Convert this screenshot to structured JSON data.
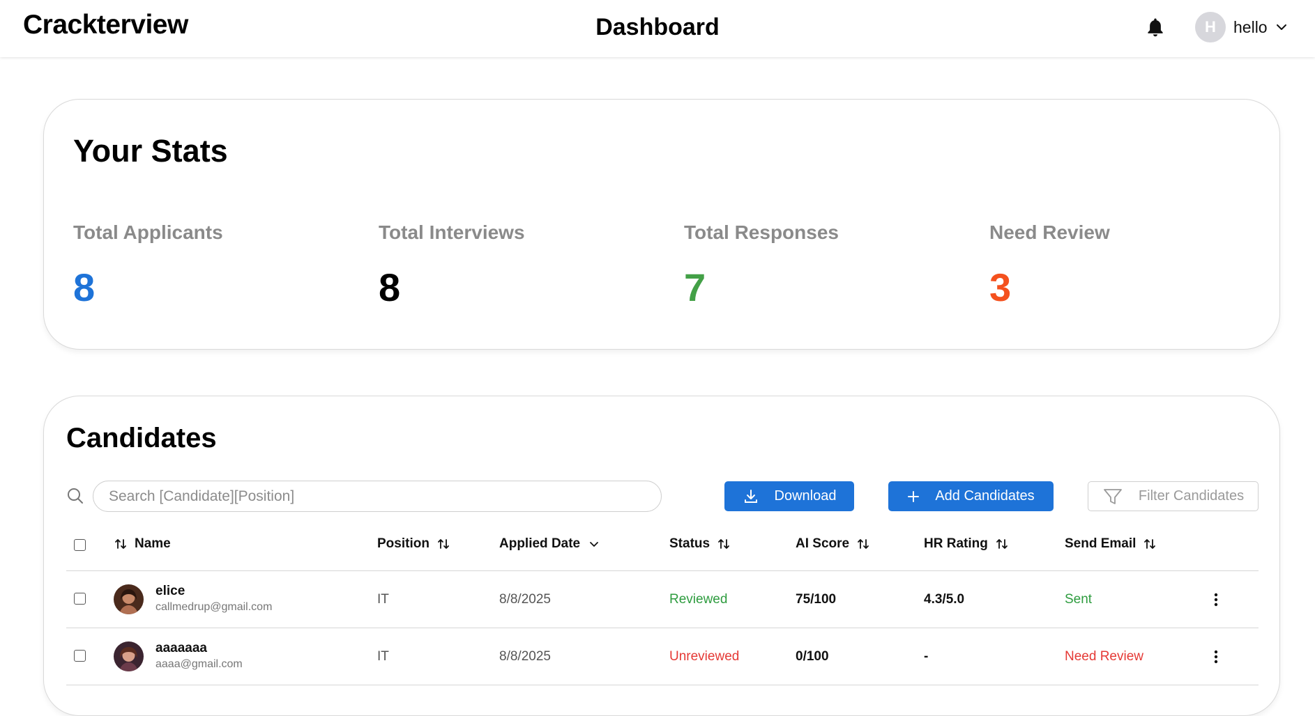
{
  "header": {
    "brand": "Crackterview",
    "title": "Dashboard",
    "user": {
      "initial": "H",
      "name": "hello"
    }
  },
  "stats": {
    "title": "Your Stats",
    "items": [
      {
        "label": "Total Applicants",
        "value": "8",
        "color": "#1e73d8"
      },
      {
        "label": "Total Interviews",
        "value": "8",
        "color": "#000000"
      },
      {
        "label": "Total Responses",
        "value": "7",
        "color": "#43a047"
      },
      {
        "label": "Need Review",
        "value": "3",
        "color": "#f4511e"
      }
    ]
  },
  "candidates": {
    "title": "Candidates",
    "search_placeholder": "Search [Candidate][Position]",
    "download_label": "Download",
    "add_label": "Add Candidates",
    "filter_label": "Filter Candidates",
    "columns": {
      "name": "Name",
      "position": "Position",
      "applied_date": "Applied Date",
      "status": "Status",
      "ai_score": "AI Score",
      "hr_rating": "HR Rating",
      "send_email": "Send Email"
    },
    "rows": [
      {
        "name": "elice",
        "email": "callmedrup@gmail.com",
        "position": "IT",
        "applied_date": "8/8/2025",
        "status": "Reviewed",
        "ai_score": "75/100",
        "hr_rating": "4.3/5.0",
        "send_email": "Sent"
      },
      {
        "name": "aaaaaaa",
        "email": "aaaa@gmail.com",
        "position": "IT",
        "applied_date": "8/8/2025",
        "status": "Unreviewed",
        "ai_score": "0/100",
        "hr_rating": "-",
        "send_email": "Need Review"
      }
    ],
    "colors": {
      "positive": "#2e9c3f",
      "negative": "#e53935"
    }
  }
}
